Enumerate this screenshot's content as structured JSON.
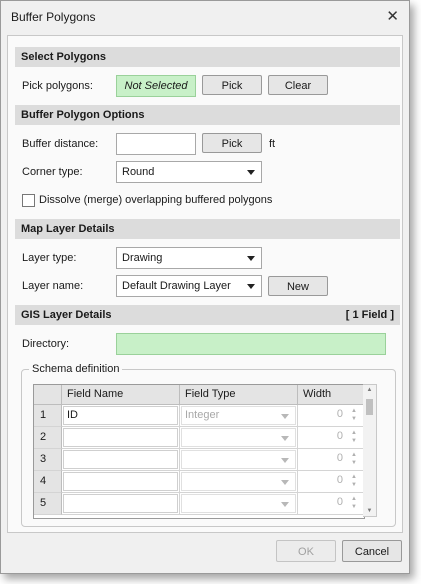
{
  "window": {
    "title": "Buffer Polygons"
  },
  "select_polygons": {
    "header": "Select Polygons",
    "pick_label": "Pick polygons:",
    "status": "Not Selected",
    "pick_button": "Pick",
    "clear_button": "Clear"
  },
  "buffer_options": {
    "header": "Buffer Polygon Options",
    "distance_label": "Buffer distance:",
    "distance_value": "",
    "pick_button": "Pick",
    "unit": "ft",
    "corner_label": "Corner type:",
    "corner_value": "Round",
    "dissolve_label": "Dissolve (merge) overlapping buffered polygons",
    "dissolve_checked": false
  },
  "map_layer": {
    "header": "Map Layer Details",
    "type_label": "Layer type:",
    "type_value": "Drawing",
    "name_label": "Layer name:",
    "name_value": "Default Drawing Layer",
    "new_button": "New"
  },
  "gis_layer": {
    "header": "GIS Layer Details",
    "field_count": "[ 1 Field ]",
    "directory_label": "Directory:",
    "directory_value": "",
    "schema_legend": "Schema definition",
    "columns": [
      "Field Name",
      "Field Type",
      "Width"
    ],
    "rows": [
      {
        "num": "1",
        "name": "ID",
        "type": "Integer",
        "width": "0"
      },
      {
        "num": "2",
        "name": "",
        "type": "",
        "width": "0"
      },
      {
        "num": "3",
        "name": "",
        "type": "",
        "width": "0"
      },
      {
        "num": "4",
        "name": "",
        "type": "",
        "width": "0"
      },
      {
        "num": "5",
        "name": "",
        "type": "",
        "width": "0"
      }
    ]
  },
  "footer": {
    "ok_button": "OK",
    "cancel_button": "Cancel"
  },
  "colors": {
    "status_bg": "#c8f0c8",
    "section_bg": "#dcdcdc"
  }
}
